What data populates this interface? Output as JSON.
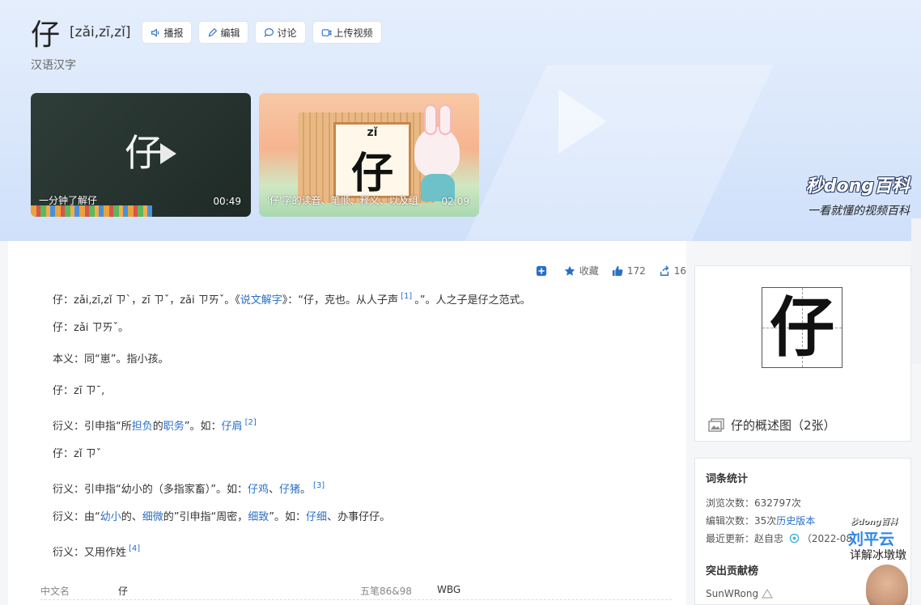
{
  "header": {
    "char": "仔",
    "pinyin": "[zǎi,zī,zǐ]",
    "subtitle": "汉语汉字",
    "buttons": [
      {
        "label": "播报",
        "icon": "speaker-icon"
      },
      {
        "label": "编辑",
        "icon": "pencil-icon"
      },
      {
        "label": "讨论",
        "icon": "chat-bubble-icon"
      },
      {
        "label": "上传视频",
        "icon": "video-camera-icon"
      }
    ]
  },
  "videos": [
    {
      "char": "仔",
      "caption": "一分钟了解仔",
      "duration": "00:49"
    },
    {
      "char": "仔",
      "pinyin": "zǐ",
      "caption": "'仔'字的读音、笔顺、释义、以及组",
      "duration": "02:09"
    }
  ],
  "brand": {
    "logo": "秒dong百科",
    "slogan": "一看就懂的视频百科"
  },
  "toolbar": {
    "collect": "收藏",
    "likes": "172",
    "shares": "16"
  },
  "content": {
    "l1": {
      "a": "仔：zǎi,zī,zǐ ㄗˋ，zī ㄗˇ，zǎi ㄗㄞˇ。《",
      "link": "说文解字",
      "b": "》：“仔，克也。从人子声",
      "sup": "[1]",
      "c": "。”。人之子是仔之范式。"
    },
    "l2": "仔：zǎi ㄗㄞˇ。",
    "l3": "本义：同“崽”。指小孩。",
    "l4": "仔：zī ㄗˉ,",
    "l5": {
      "a": "衍义：引申指“所",
      "link1": "担负",
      "b": "的",
      "link2": "职务",
      "c": "”。如：",
      "link3": "仔肩",
      "sup": "[2]"
    },
    "l6": "仔：zǐ ㄗˇ",
    "l7": {
      "a": "衍义：引申指“幼小的（多指家畜）”。如：",
      "link1": "仔鸡",
      "b": "、",
      "link2": "仔猪",
      "c": "。",
      "sup": "[3]"
    },
    "l8": {
      "a": "衍义：由“",
      "link1": "幼小",
      "b": "的、",
      "link2": "细微",
      "c": "的”引申指“周密，",
      "link3": "细致",
      "d": "”。如：",
      "link4": "仔细",
      "e": "、办事仔仔。"
    },
    "l9": {
      "a": "衍义：又用作姓",
      "sup": "[4]"
    }
  },
  "info": {
    "k1": "中文名",
    "v1": "仔",
    "k2": "五笔86&98",
    "v2": "WBG"
  },
  "sidebar": {
    "glyph": "仔",
    "caption": "仔的概述图（2张）",
    "stats_title": "词条统计",
    "views_label": "浏览次数：",
    "views": "632797次",
    "edits_label": "编辑次数：",
    "edits": "35次",
    "history_link": "历史版本",
    "updated_label": "最近更新：",
    "updated_user": "赵自忠",
    "updated_date": "（2022-08",
    "contrib_title": "突出贡献榜",
    "contributor": "SunWRong"
  },
  "overlay": {
    "logo": "秒dong百科",
    "name": "刘平云",
    "sub": "详解冰墩墩"
  }
}
